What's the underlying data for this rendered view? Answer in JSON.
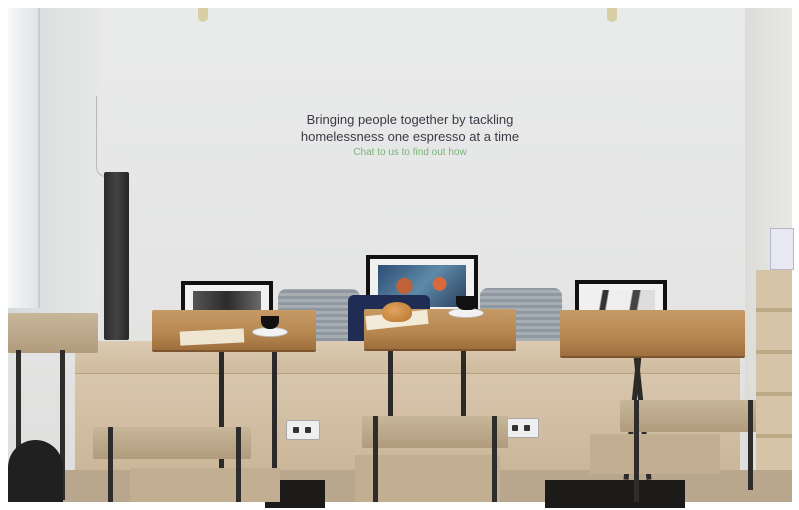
{
  "wall_text": {
    "line1": "Bringing people together by tackling",
    "line2": "homelessness one espresso at a time",
    "cta": "Chat to us to find out how"
  },
  "colors": {
    "slogan_text": "#3b3a46",
    "cta_text": "#7bb37a"
  }
}
